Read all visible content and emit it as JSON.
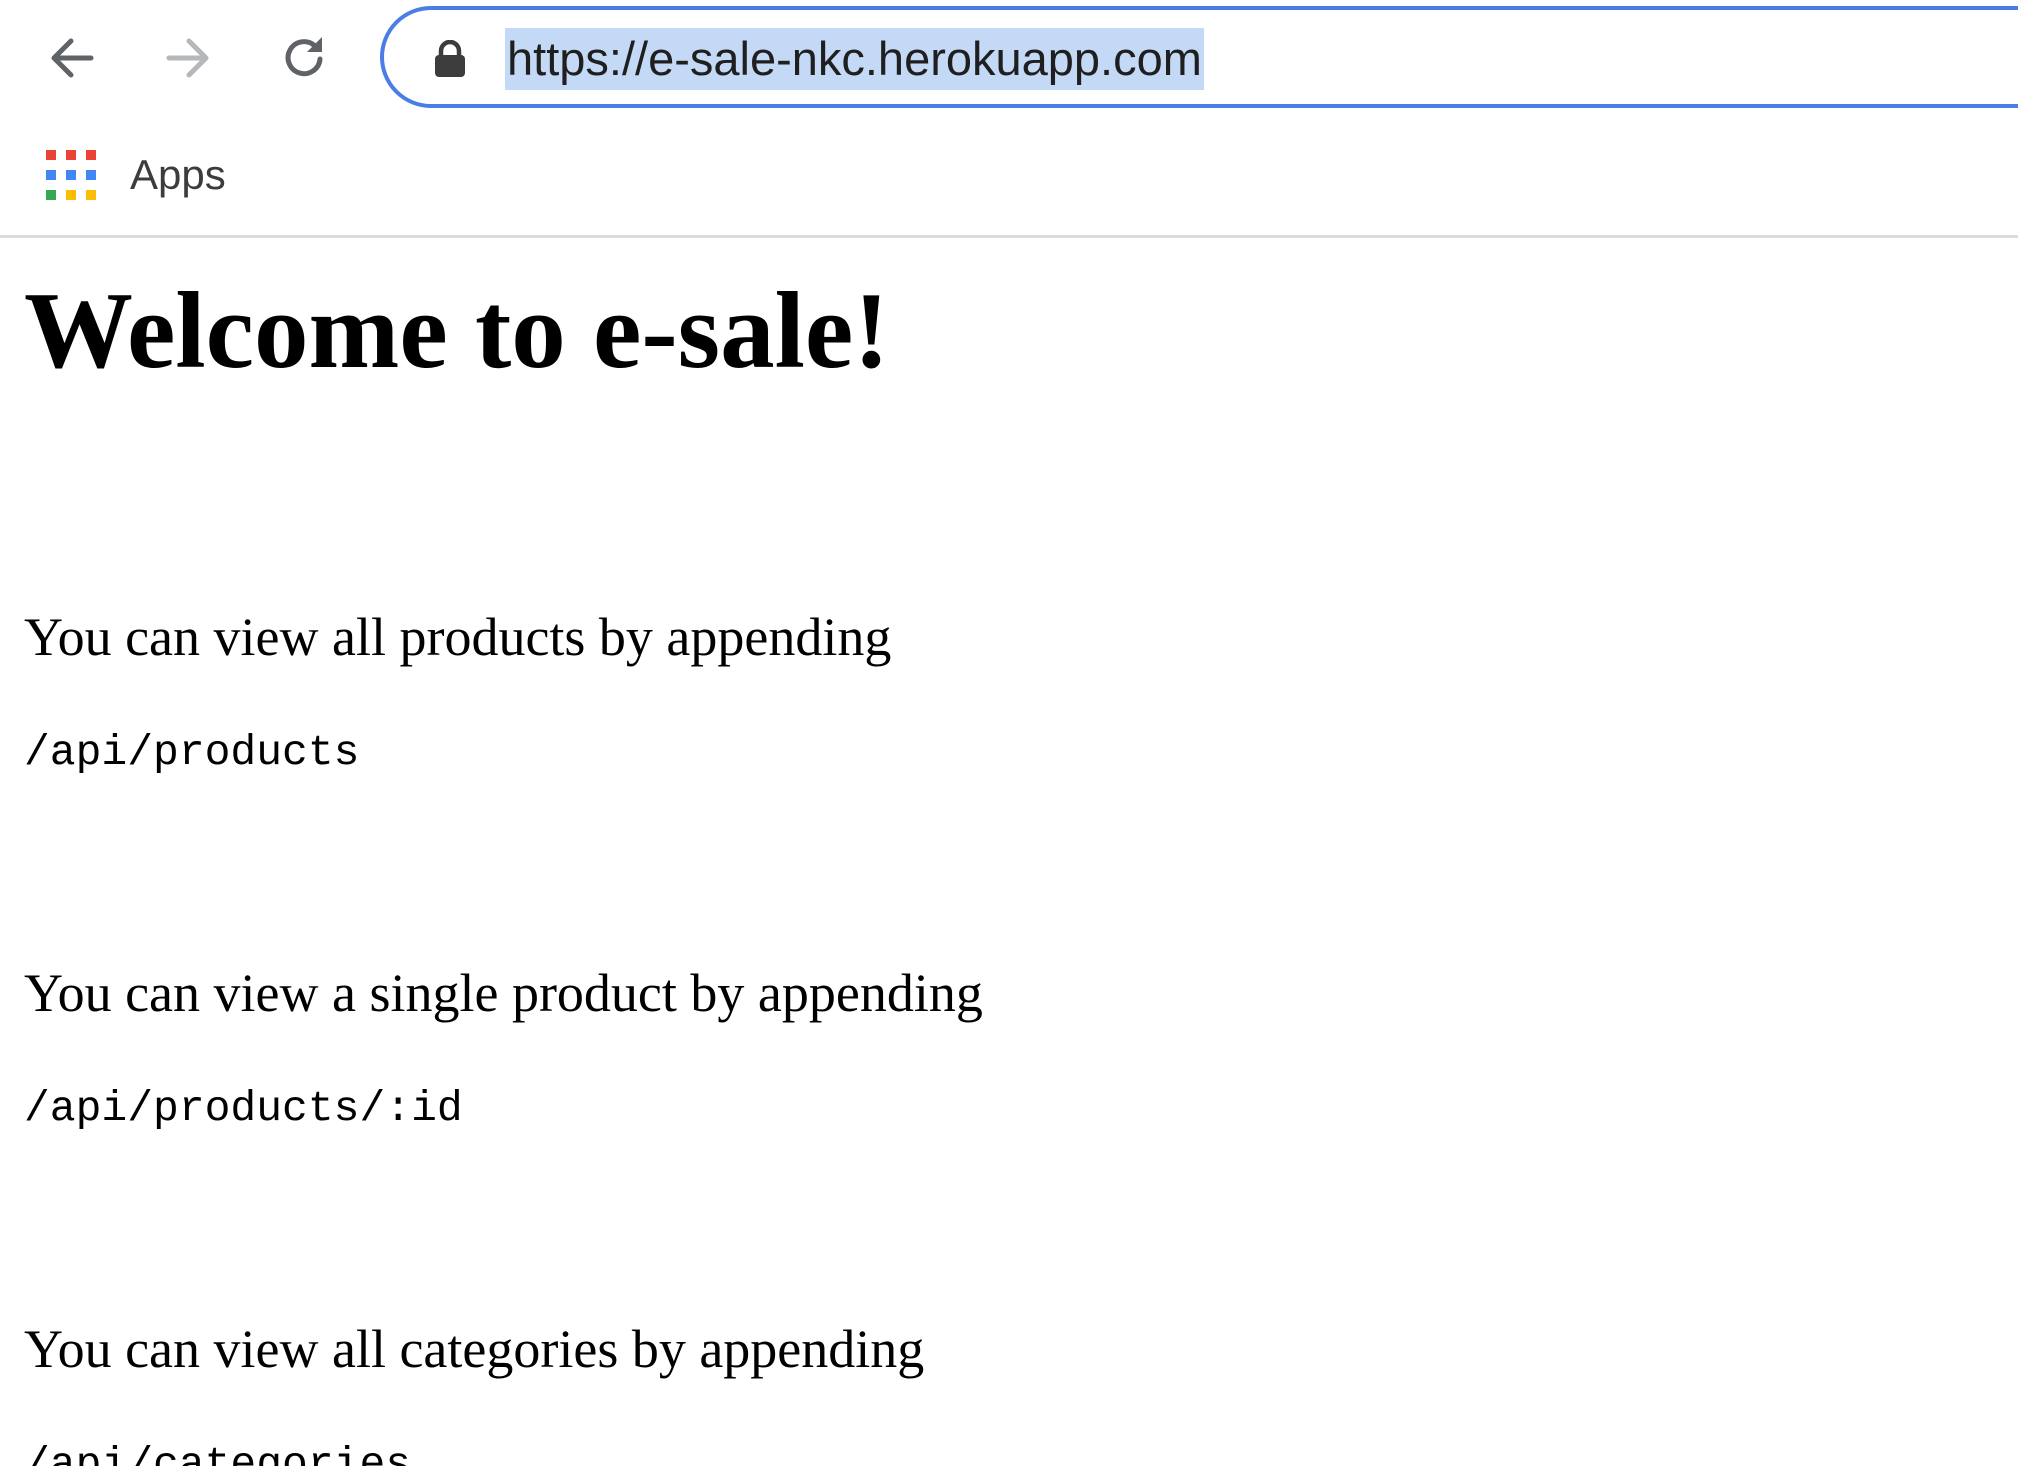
{
  "browser": {
    "toolbar": {
      "back_icon": "arrow-left-icon",
      "forward_icon": "arrow-right-icon",
      "reload_icon": "reload-icon",
      "lock_icon": "lock-icon",
      "url": "https://e-sale-nkc.herokuapp.com",
      "url_selected": true,
      "focus_color": "#4a7de6",
      "selection_color": "#c4d9f6"
    },
    "bookmarks": {
      "apps_icon": "apps-grid-icon",
      "apps_label": "Apps",
      "apps_colors": [
        "#ea4335",
        "#ea4335",
        "#ea4335",
        "#4285f4",
        "#4285f4",
        "#4285f4",
        "#34a853",
        "#fbbc05",
        "#fbbc05"
      ]
    }
  },
  "page": {
    "title": "Welcome to e-sale!",
    "sections": [
      {
        "text": "You can view all products by appending",
        "code": "/api/products"
      },
      {
        "text": "You can view a single product by appending",
        "code": "/api/products/:id"
      },
      {
        "text": "You can view all categories by appending",
        "code": "/api/categories"
      }
    ]
  }
}
